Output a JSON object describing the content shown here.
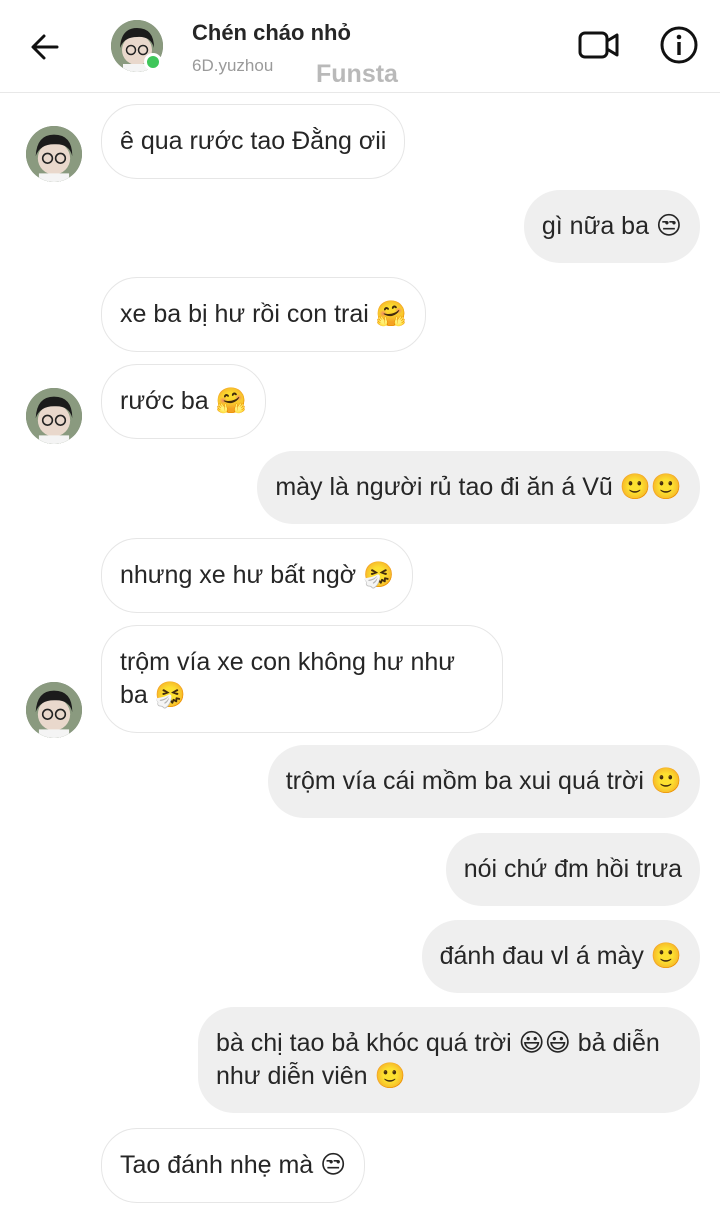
{
  "header": {
    "name": "Chén cháo nhỏ",
    "username": "6D.yuzhou",
    "watermark": "Funsta"
  },
  "icons": {
    "back": "arrow-left-icon",
    "video": "video-camera-icon",
    "info": "info-icon"
  },
  "colors": {
    "online": "#3fc65a",
    "incoming_bg": "#ffffff",
    "outgoing_bg": "#efefef"
  },
  "messages": [
    {
      "side": "in",
      "text": "ê qua rước tao Đằng ơii",
      "avatar": true
    },
    {
      "side": "out",
      "text": "gì nữa ba 😒"
    },
    {
      "side": "in",
      "text": "xe ba bị hư rồi con trai 🤗"
    },
    {
      "side": "in",
      "text": "rước ba 🤗",
      "avatar": true
    },
    {
      "side": "out",
      "text": "mày là người rủ tao đi ăn á Vũ 🙂🙂"
    },
    {
      "side": "in",
      "text": "nhưng xe hư bất ngờ 🤧"
    },
    {
      "side": "in",
      "text": "trộm vía xe con không hư như ba 🤧",
      "avatar": true
    },
    {
      "side": "out",
      "text": "trộm vía cái mồm ba xui quá trời 🙂"
    },
    {
      "side": "out",
      "text": "nói chứ đm hồi trưa"
    },
    {
      "side": "out",
      "text": "đánh đau vl á mày 🙂"
    },
    {
      "side": "out",
      "text": "bà chị tao bả khóc quá trời 😃😃 bả diễn như diễn viên 🙂"
    },
    {
      "side": "in",
      "text": "Tao đánh nhẹ mà 😒"
    }
  ]
}
